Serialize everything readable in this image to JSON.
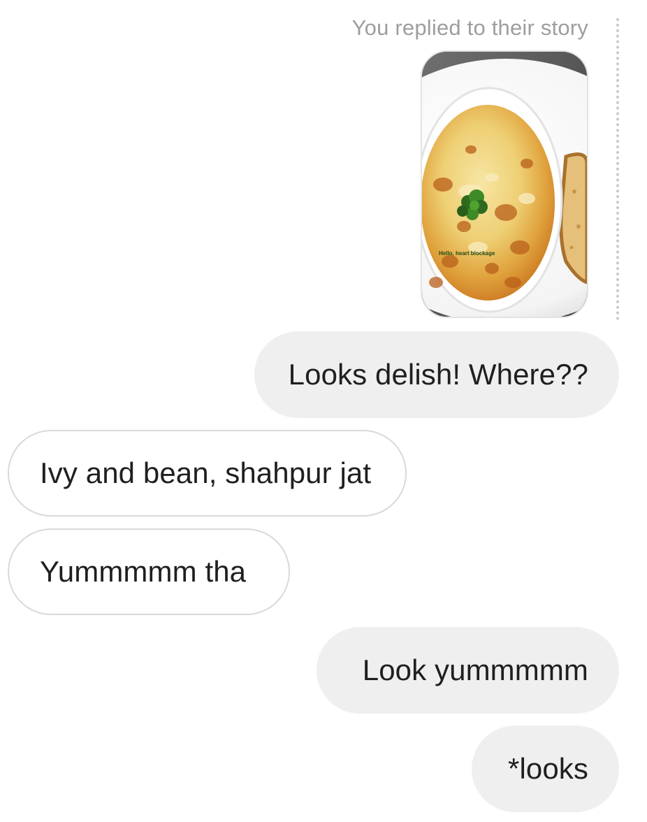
{
  "story_reply": {
    "caption": "You replied to their story",
    "image_overlay_text": "Hello, heart blockage",
    "image_subject": "baked cheese dish in white bowl with parsley garnish and toast"
  },
  "messages": [
    {
      "direction": "outgoing",
      "text": "Looks delish! Where??"
    },
    {
      "direction": "incoming",
      "text": "Ivy and bean, shahpur jat"
    },
    {
      "direction": "incoming",
      "text": "Yummmmm tha"
    },
    {
      "direction": "outgoing",
      "text": "Look yummmmm"
    },
    {
      "direction": "outgoing",
      "text": "*looks"
    }
  ],
  "colors": {
    "outgoing_bubble": "#efefef",
    "incoming_bubble_border": "#d9d9d9",
    "caption_text": "#9e9e9e",
    "message_text": "#1f1f1f"
  }
}
